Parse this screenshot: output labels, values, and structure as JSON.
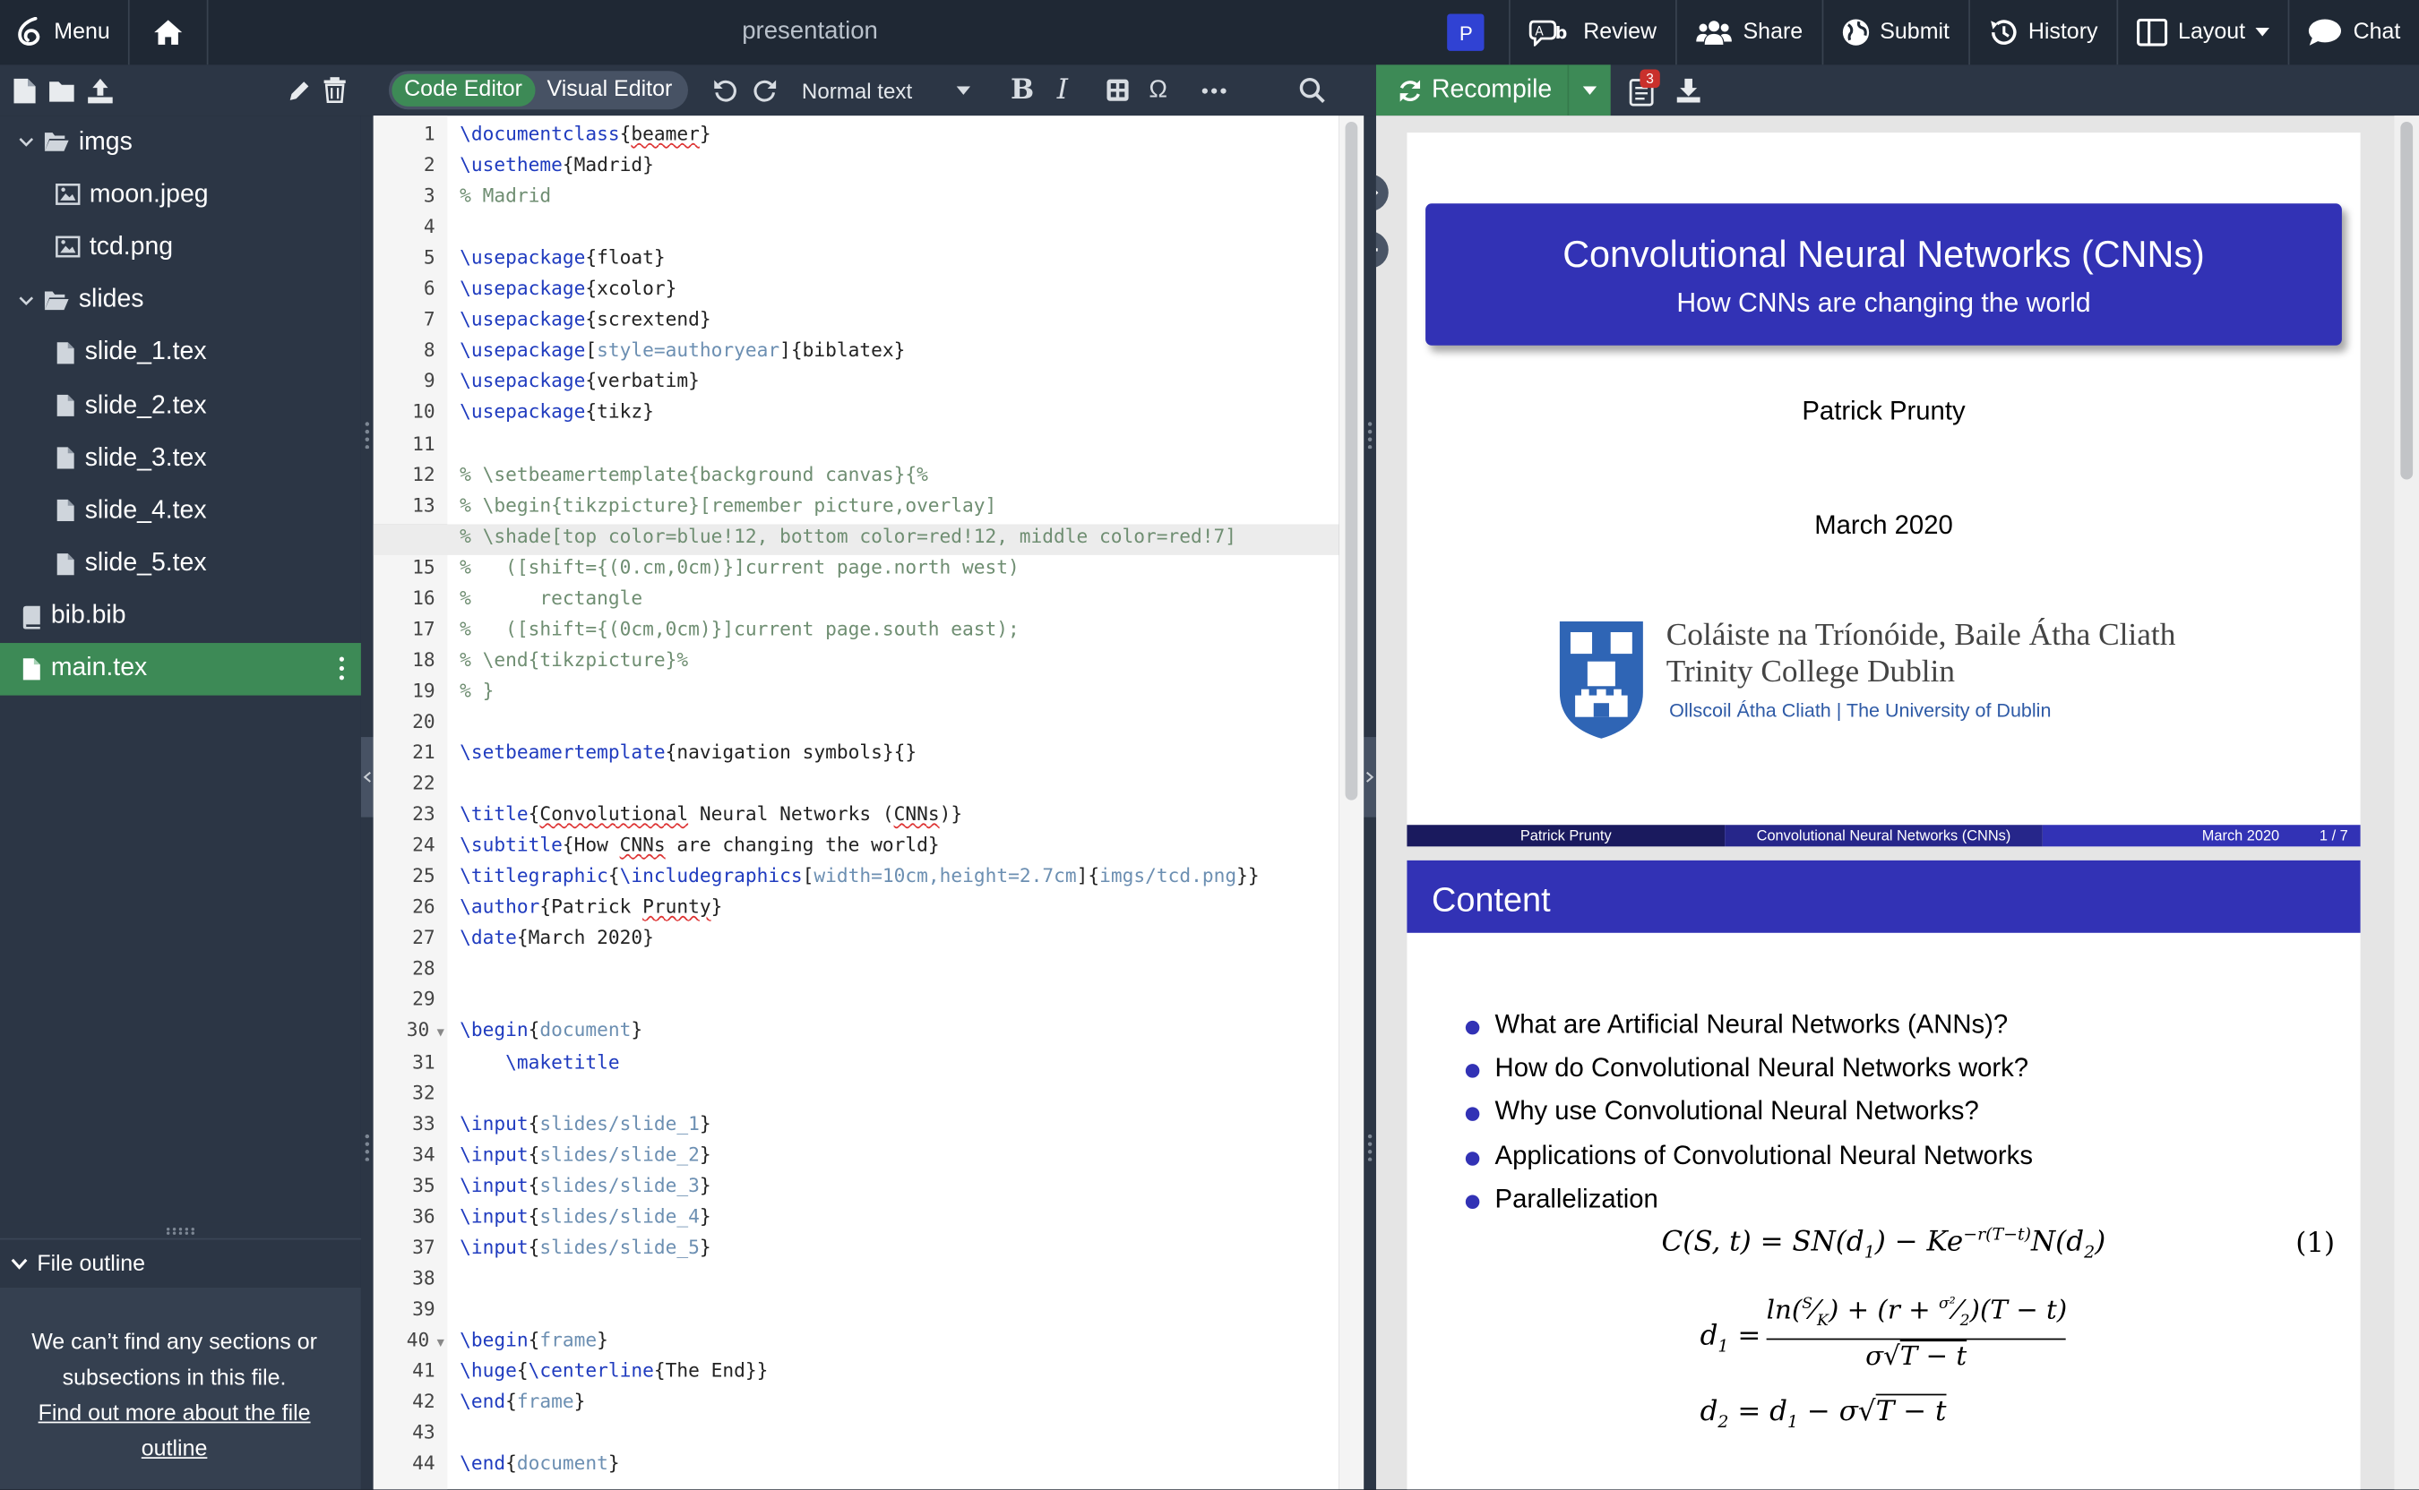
{
  "topbar": {
    "menu_label": "Menu",
    "project_title": "presentation",
    "avatar_initial": "P",
    "review_label": "Review",
    "share_label": "Share",
    "submit_label": "Submit",
    "history_label": "History",
    "layout_label": "Layout",
    "chat_label": "Chat"
  },
  "editor_toolbar": {
    "code_editor_label": "Code Editor",
    "visual_editor_label": "Visual Editor",
    "text_style": "Normal text",
    "bold_label": "B",
    "italic_label": "I",
    "omega_label": "Ω"
  },
  "pdf_toolbar": {
    "recompile_label": "Recompile",
    "log_count": "3"
  },
  "file_tree": {
    "items": [
      {
        "label": "imgs",
        "type": "folder",
        "level": 0
      },
      {
        "label": "moon.jpeg",
        "type": "image",
        "level": 1
      },
      {
        "label": "tcd.png",
        "type": "image",
        "level": 1
      },
      {
        "label": "slides",
        "type": "folder",
        "level": 0
      },
      {
        "label": "slide_1.tex",
        "type": "file",
        "level": 1
      },
      {
        "label": "slide_2.tex",
        "type": "file",
        "level": 1
      },
      {
        "label": "slide_3.tex",
        "type": "file",
        "level": 1
      },
      {
        "label": "slide_4.tex",
        "type": "file",
        "level": 1
      },
      {
        "label": "slide_5.tex",
        "type": "file",
        "level": 1
      },
      {
        "label": "bib.bib",
        "type": "bib",
        "level": 0
      },
      {
        "label": "main.tex",
        "type": "file",
        "level": 0,
        "selected": true
      }
    ]
  },
  "file_outline": {
    "title": "File outline",
    "empty_message": "We can’t find any sections or subsections in this file.",
    "link_text": "Find out more about the file outline"
  },
  "editor": {
    "active_line": 14,
    "lines": [
      "\\documentclass{beamer}",
      "\\usetheme{Madrid}",
      "% Madrid",
      "",
      "\\usepackage{float}",
      "\\usepackage{xcolor}",
      "\\usepackage{scrextend}",
      "\\usepackage[style=authoryear]{biblatex}",
      "\\usepackage{verbatim}",
      "\\usepackage{tikz}",
      "",
      "% \\setbeamertemplate{background canvas}{%",
      "% \\begin{tikzpicture}[remember picture,overlay]",
      "% \\shade[top color=blue!12, bottom color=red!12, middle color=red!7]",
      "%   ([shift={(0.cm,0cm)}]current page.north west)",
      "%      rectangle",
      "%   ([shift={(0cm,0cm)}]current page.south east);",
      "% \\end{tikzpicture}%",
      "% }",
      "",
      "\\setbeamertemplate{navigation symbols}{}",
      "",
      "\\title{Convolutional Neural Networks (CNNs)}",
      "\\subtitle{How CNNs are changing the world}",
      "\\titlegraphic{\\includegraphics[width=10cm,height=2.7cm]{imgs/tcd.png}}",
      "\\author{Patrick Prunty}",
      "\\date{March 2020}",
      "",
      "",
      "\\begin{document}",
      "    \\maketitle",
      "",
      "\\input{slides/slide_1}",
      "\\input{slides/slide_2}",
      "\\input{slides/slide_3}",
      "\\input{slides/slide_4}",
      "\\input{slides/slide_5}",
      "",
      "",
      "\\begin{frame}",
      "\\huge{\\centerline{The End}}",
      "\\end{frame}",
      "",
      "\\end{document}"
    ]
  },
  "pdf": {
    "slide1": {
      "title": "Convolutional Neural Networks (CNNs)",
      "subtitle": "How CNNs are changing the world",
      "author": "Patrick Prunty",
      "date": "March 2020",
      "logo_line1": "Coláiste na Tríonóide, Baile Átha Cliath",
      "logo_line2": "Trinity College Dublin",
      "logo_line3": "Ollscoil Átha Cliath | The University of Dublin",
      "footer_author": "Patrick Prunty",
      "footer_title": "Convolutional Neural Networks (CNNs)",
      "footer_date": "March 2020",
      "footer_page": "1 / 7"
    },
    "slide2": {
      "heading": "Content",
      "bullets": [
        "What are Artificial Neural Networks (ANNs)?",
        "How do Convolutional Neural Networks work?",
        "Why use Convolutional Neural Networks?",
        "Applications of Convolutional Neural Networks",
        "Parallelization"
      ],
      "eq_number": "(1)"
    }
  },
  "colors": {
    "accent_green": "#3d8a56",
    "beamer_blue": "#3232b5",
    "footer_dark": "#1a1a5e"
  }
}
